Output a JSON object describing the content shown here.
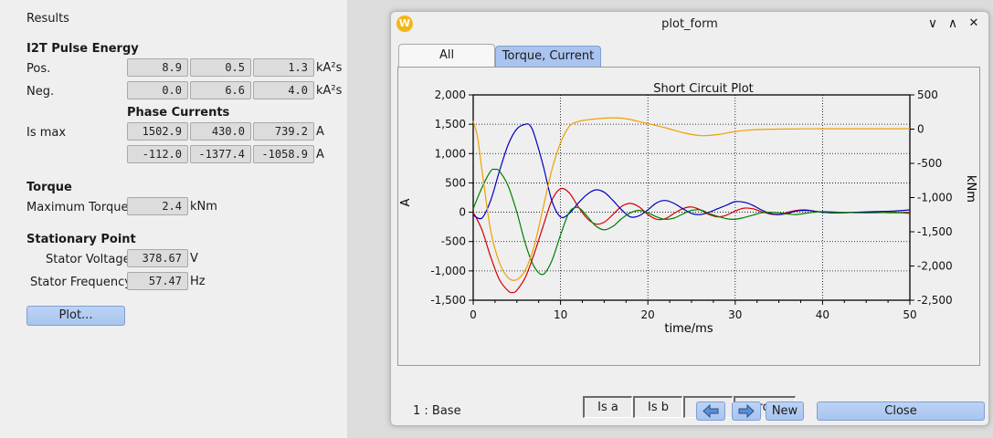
{
  "results_title": "Results",
  "i2t": {
    "heading": "I2T Pulse Energy",
    "pos_label": "Pos.",
    "pos_values": [
      "8.9",
      "0.5",
      "1.3"
    ],
    "neg_label": "Neg.",
    "neg_values": [
      "0.0",
      "6.6",
      "4.0"
    ],
    "unit": "kA²s"
  },
  "phase": {
    "heading": "Phase Currents",
    "is_max_label": "Is max",
    "row1": [
      "1502.9",
      "430.0",
      "739.2"
    ],
    "row2": [
      "-112.0",
      "-1377.4",
      "-1058.9"
    ],
    "unit": "A"
  },
  "torque": {
    "heading": "Torque",
    "max_label": "Maximum Torque",
    "max_value": "2.4",
    "unit": "kNm"
  },
  "stationary": {
    "heading": "Stationary Point",
    "voltage_label": "Stator Voltage",
    "voltage_value": "378.67",
    "voltage_unit": "V",
    "freq_label": "Stator Frequency",
    "freq_value": "57.47",
    "freq_unit": "Hz"
  },
  "plot_button": "Plot...",
  "window": {
    "title": "plot_form",
    "logo_letter": "W",
    "controls": [
      "∨",
      "∧",
      "✕"
    ],
    "tabs": [
      "All",
      "Torque, Current"
    ],
    "status": "1 : Base",
    "new_label": "New",
    "close_label": "Close",
    "prev_icon": "arrow-left-icon",
    "next_icon": "arrow-right-icon"
  },
  "legend_buttons": [
    "Is a",
    "Is b",
    "Is c",
    "Torque"
  ],
  "colors": {
    "accent": "#a9c4ee",
    "is_a": "#d40000",
    "is_b": "#0000c0",
    "is_c": "#008000",
    "torque": "#f0a000"
  },
  "chart_data": {
    "type": "line",
    "title": "Short Circuit Plot",
    "xlabel": "time/ms",
    "ylabel": "A",
    "y2label": "kNm",
    "xlim": [
      0,
      50
    ],
    "ylim": [
      -1500,
      2000
    ],
    "y2lim": [
      -2500,
      500
    ],
    "xticks": [
      "0",
      "10",
      "20",
      "30",
      "40",
      "50"
    ],
    "yticks": [
      "2,000",
      "1,500",
      "1,000",
      "500",
      "0",
      "-500",
      "-1,000",
      "-1,500"
    ],
    "y2ticks": [
      "500",
      "0",
      "-500",
      "-1,000",
      "-1,500",
      "-2,000",
      "-2,500"
    ],
    "grid": true,
    "series": [
      {
        "name": "Is a",
        "axis": "left",
        "color": "#d40000",
        "x": [
          0,
          1,
          2,
          3,
          4,
          4.5,
          5,
          6,
          7,
          8,
          9,
          10,
          11,
          12,
          13,
          14,
          15,
          16,
          17,
          18,
          19,
          20,
          21,
          22,
          23,
          24,
          25,
          26,
          27,
          28,
          29,
          30,
          31,
          32,
          33,
          34,
          35,
          36,
          37,
          38,
          39,
          40,
          42,
          44,
          46,
          48,
          50
        ],
        "y": [
          0,
          -300,
          -760,
          -1150,
          -1340,
          -1370,
          -1330,
          -1100,
          -700,
          -240,
          200,
          400,
          330,
          100,
          -100,
          -200,
          -170,
          -40,
          100,
          150,
          90,
          -40,
          -120,
          -110,
          -20,
          60,
          90,
          40,
          -40,
          -80,
          -50,
          20,
          70,
          60,
          10,
          -30,
          -40,
          0,
          30,
          40,
          20,
          0,
          -10,
          0,
          0,
          -10,
          0
        ]
      },
      {
        "name": "Is b",
        "axis": "left",
        "color": "#0000c0",
        "x": [
          0,
          1,
          2,
          3,
          4,
          5,
          6,
          6.5,
          7,
          8,
          9,
          10,
          11,
          12,
          13,
          14,
          15,
          16,
          17,
          18,
          19,
          20,
          21,
          22,
          23,
          24,
          25,
          26,
          27,
          28,
          29,
          30,
          31,
          32,
          33,
          34,
          35,
          36,
          37,
          38,
          39,
          40,
          42,
          44,
          46,
          48,
          50
        ],
        "y": [
          -50,
          -100,
          200,
          700,
          1150,
          1420,
          1500,
          1480,
          1320,
          800,
          200,
          -80,
          -20,
          150,
          300,
          380,
          340,
          200,
          40,
          -80,
          -60,
          40,
          160,
          200,
          150,
          60,
          -20,
          -40,
          0,
          60,
          120,
          180,
          170,
          120,
          40,
          -20,
          -40,
          -20,
          20,
          30,
          20,
          0,
          -10,
          0,
          10,
          20,
          40
        ]
      },
      {
        "name": "Is c",
        "axis": "left",
        "color": "#008000",
        "x": [
          0,
          1,
          2,
          2.5,
          3,
          4,
          5,
          6,
          7,
          8,
          9,
          10,
          11,
          12,
          13,
          14,
          15,
          16,
          17,
          18,
          19,
          20,
          21,
          22,
          23,
          24,
          25,
          26,
          27,
          28,
          29,
          30,
          31,
          32,
          33,
          34,
          35,
          36,
          37,
          38,
          39,
          40,
          42,
          44,
          46,
          48,
          50
        ],
        "y": [
          60,
          420,
          700,
          730,
          700,
          450,
          0,
          -550,
          -930,
          -1060,
          -830,
          -390,
          0,
          80,
          -60,
          -230,
          -300,
          -240,
          -110,
          -10,
          30,
          -10,
          -80,
          -120,
          -100,
          -30,
          30,
          40,
          -20,
          -70,
          -110,
          -120,
          -90,
          -50,
          -10,
          0,
          -10,
          -30,
          -40,
          -20,
          0,
          10,
          0,
          -10,
          -10,
          0,
          -20
        ]
      },
      {
        "name": "Torque",
        "axis": "right",
        "color": "#f0a000",
        "x": [
          0,
          0.5,
          1,
          2,
          3,
          4,
          5,
          6,
          7,
          8,
          9,
          10,
          11,
          12,
          13,
          14,
          15,
          16,
          17,
          18,
          19,
          20,
          22,
          24,
          26,
          28,
          30,
          32,
          35,
          40,
          45,
          50
        ],
        "y": [
          120,
          -120,
          -600,
          -1480,
          -1950,
          -2170,
          -2200,
          -2050,
          -1700,
          -1150,
          -600,
          -200,
          40,
          110,
          135,
          150,
          160,
          165,
          160,
          140,
          110,
          80,
          20,
          -50,
          -95,
          -80,
          -35,
          -10,
          0,
          5,
          5,
          5
        ]
      }
    ]
  }
}
